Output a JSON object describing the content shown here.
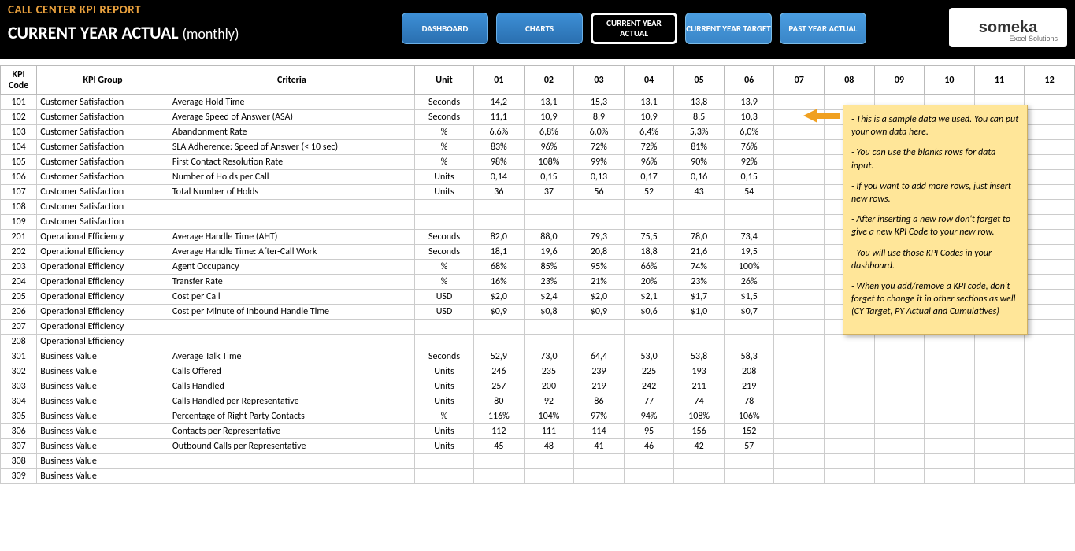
{
  "header": {
    "title1": "CALL CENTER KPI REPORT",
    "title2": "CURRENT YEAR ACTUAL",
    "title2_sub": "(monthly)"
  },
  "nav": {
    "dashboard": "DASHBOARD",
    "charts": "CHARTS",
    "cya": "CURRENT YEAR ACTUAL",
    "cyt": "CURRENT YEAR TARGET",
    "pya": "PAST YEAR ACTUAL"
  },
  "logo": {
    "main": "someka",
    "sub": "Excel Solutions"
  },
  "columns": {
    "code": "KPI Code",
    "group": "KPI Group",
    "criteria": "Criteria",
    "unit": "Unit",
    "m01": "01",
    "m02": "02",
    "m03": "03",
    "m04": "04",
    "m05": "05",
    "m06": "06",
    "m07": "07",
    "m08": "08",
    "m09": "09",
    "m10": "10",
    "m11": "11",
    "m12": "12"
  },
  "rows": [
    {
      "code": "101",
      "group": "Customer Satisfaction",
      "criteria": "Average Hold Time",
      "unit": "Seconds",
      "v": [
        "14,2",
        "13,1",
        "15,3",
        "13,1",
        "13,8",
        "13,9",
        "",
        "",
        "",
        "",
        "",
        ""
      ]
    },
    {
      "code": "102",
      "group": "Customer Satisfaction",
      "criteria": "Average Speed of Answer (ASA)",
      "unit": "Seconds",
      "v": [
        "11,1",
        "10,9",
        "8,9",
        "10,9",
        "8,5",
        "10,3",
        "",
        "",
        "",
        "",
        "",
        ""
      ]
    },
    {
      "code": "103",
      "group": "Customer Satisfaction",
      "criteria": "Abandonment Rate",
      "unit": "%",
      "v": [
        "6,6%",
        "6,8%",
        "6,0%",
        "6,4%",
        "5,3%",
        "6,0%",
        "",
        "",
        "",
        "",
        "",
        ""
      ]
    },
    {
      "code": "104",
      "group": "Customer Satisfaction",
      "criteria": "SLA Adherence: Speed of Answer (< 10 sec)",
      "unit": "%",
      "v": [
        "83%",
        "96%",
        "72%",
        "72%",
        "81%",
        "76%",
        "",
        "",
        "",
        "",
        "",
        ""
      ]
    },
    {
      "code": "105",
      "group": "Customer Satisfaction",
      "criteria": "First Contact Resolution Rate",
      "unit": "%",
      "v": [
        "98%",
        "108%",
        "99%",
        "96%",
        "90%",
        "92%",
        "",
        "",
        "",
        "",
        "",
        ""
      ]
    },
    {
      "code": "106",
      "group": "Customer Satisfaction",
      "criteria": "Number of Holds per Call",
      "unit": "Units",
      "v": [
        "0,14",
        "0,15",
        "0,13",
        "0,17",
        "0,16",
        "0,15",
        "",
        "",
        "",
        "",
        "",
        ""
      ]
    },
    {
      "code": "107",
      "group": "Customer Satisfaction",
      "criteria": "Total Number of Holds",
      "unit": "Units",
      "v": [
        "36",
        "37",
        "56",
        "52",
        "43",
        "54",
        "",
        "",
        "",
        "",
        "",
        ""
      ]
    },
    {
      "code": "108",
      "group": "Customer Satisfaction",
      "criteria": "",
      "unit": "",
      "v": [
        "",
        "",
        "",
        "",
        "",
        "",
        "",
        "",
        "",
        "",
        "",
        ""
      ]
    },
    {
      "code": "109",
      "group": "Customer Satisfaction",
      "criteria": "",
      "unit": "",
      "v": [
        "",
        "",
        "",
        "",
        "",
        "",
        "",
        "",
        "",
        "",
        "",
        ""
      ]
    },
    {
      "code": "201",
      "group": "Operational Efficiency",
      "criteria": "Average Handle Time (AHT)",
      "unit": "Seconds",
      "v": [
        "82,0",
        "88,0",
        "79,3",
        "75,5",
        "78,0",
        "73,4",
        "",
        "",
        "",
        "",
        "",
        ""
      ]
    },
    {
      "code": "202",
      "group": "Operational Efficiency",
      "criteria": "Average Handle Time: After-Call Work",
      "unit": "Seconds",
      "v": [
        "18,1",
        "19,6",
        "20,8",
        "18,8",
        "21,6",
        "19,5",
        "",
        "",
        "",
        "",
        "",
        ""
      ]
    },
    {
      "code": "203",
      "group": "Operational Efficiency",
      "criteria": "Agent Occupancy",
      "unit": "%",
      "v": [
        "68%",
        "85%",
        "95%",
        "66%",
        "74%",
        "100%",
        "",
        "",
        "",
        "",
        "",
        ""
      ]
    },
    {
      "code": "204",
      "group": "Operational Efficiency",
      "criteria": "Transfer Rate",
      "unit": "%",
      "v": [
        "16%",
        "23%",
        "21%",
        "20%",
        "23%",
        "26%",
        "",
        "",
        "",
        "",
        "",
        ""
      ]
    },
    {
      "code": "205",
      "group": "Operational Efficiency",
      "criteria": "Cost per Call",
      "unit": "USD",
      "v": [
        "$2,0",
        "$2,4",
        "$2,0",
        "$2,1",
        "$1,7",
        "$1,5",
        "",
        "",
        "",
        "",
        "",
        ""
      ]
    },
    {
      "code": "206",
      "group": "Operational Efficiency",
      "criteria": "Cost per Minute of Inbound Handle Time",
      "unit": "USD",
      "v": [
        "$0,9",
        "$0,8",
        "$0,9",
        "$0,6",
        "$1,0",
        "$0,7",
        "",
        "",
        "",
        "",
        "",
        ""
      ]
    },
    {
      "code": "207",
      "group": "Operational Efficiency",
      "criteria": "",
      "unit": "",
      "v": [
        "",
        "",
        "",
        "",
        "",
        "",
        "",
        "",
        "",
        "",
        "",
        ""
      ]
    },
    {
      "code": "208",
      "group": "Operational Efficiency",
      "criteria": "",
      "unit": "",
      "v": [
        "",
        "",
        "",
        "",
        "",
        "",
        "",
        "",
        "",
        "",
        "",
        ""
      ]
    },
    {
      "code": "301",
      "group": "Business Value",
      "criteria": "Average Talk Time",
      "unit": "Seconds",
      "v": [
        "52,9",
        "73,0",
        "64,4",
        "53,0",
        "53,8",
        "58,3",
        "",
        "",
        "",
        "",
        "",
        ""
      ]
    },
    {
      "code": "302",
      "group": "Business Value",
      "criteria": "Calls Offered",
      "unit": "Units",
      "v": [
        "246",
        "235",
        "239",
        "225",
        "193",
        "208",
        "",
        "",
        "",
        "",
        "",
        ""
      ]
    },
    {
      "code": "303",
      "group": "Business Value",
      "criteria": "Calls Handled",
      "unit": "Units",
      "v": [
        "257",
        "200",
        "219",
        "242",
        "211",
        "219",
        "",
        "",
        "",
        "",
        "",
        ""
      ]
    },
    {
      "code": "304",
      "group": "Business Value",
      "criteria": "Calls Handled per Representative",
      "unit": "Units",
      "v": [
        "80",
        "92",
        "86",
        "77",
        "74",
        "78",
        "",
        "",
        "",
        "",
        "",
        ""
      ]
    },
    {
      "code": "305",
      "group": "Business Value",
      "criteria": "Percentage of Right Party Contacts",
      "unit": "%",
      "v": [
        "116%",
        "104%",
        "97%",
        "94%",
        "108%",
        "106%",
        "",
        "",
        "",
        "",
        "",
        ""
      ]
    },
    {
      "code": "306",
      "group": "Business Value",
      "criteria": "Contacts per Representative",
      "unit": "Units",
      "v": [
        "112",
        "111",
        "114",
        "95",
        "156",
        "152",
        "",
        "",
        "",
        "",
        "",
        ""
      ]
    },
    {
      "code": "307",
      "group": "Business Value",
      "criteria": "Outbound Calls per Representative",
      "unit": "Units",
      "v": [
        "45",
        "48",
        "41",
        "46",
        "42",
        "57",
        "",
        "",
        "",
        "",
        "",
        ""
      ]
    },
    {
      "code": "308",
      "group": "Business Value",
      "criteria": "",
      "unit": "",
      "v": [
        "",
        "",
        "",
        "",
        "",
        "",
        "",
        "",
        "",
        "",
        "",
        ""
      ]
    },
    {
      "code": "309",
      "group": "Business Value",
      "criteria": "",
      "unit": "",
      "v": [
        "",
        "",
        "",
        "",
        "",
        "",
        "",
        "",
        "",
        "",
        "",
        ""
      ]
    }
  ],
  "callout": {
    "p1": "- This is a sample data we used. You can put your own data here.",
    "p2": "- You can use the blanks rows for data input.",
    "p3": "- If you want to add more rows, just insert new rows.",
    "p4": "- After inserting a new row don't forget to give a new KPI Code to your new row.",
    "p5": "- You will use those KPI Codes in your dashboard.",
    "p6": "- When you add/remove a KPI code, don't forget to change it in other sections as well (CY Target, PY Actual and Cumulatives)"
  }
}
